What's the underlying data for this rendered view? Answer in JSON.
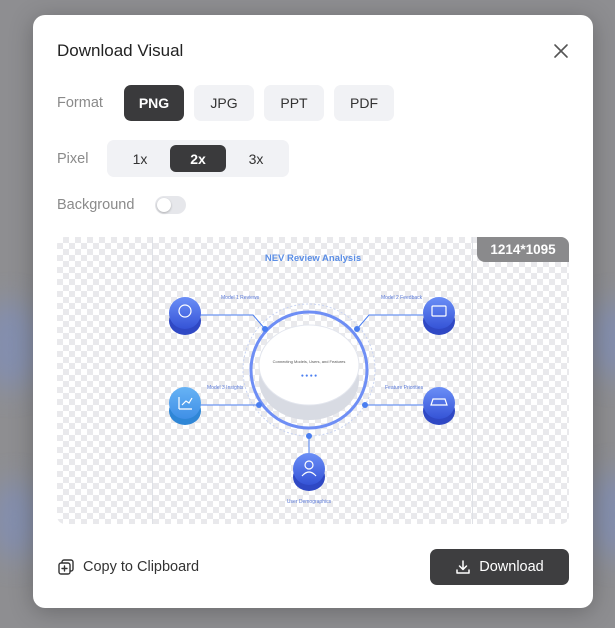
{
  "modal": {
    "title": "Download Visual"
  },
  "format": {
    "label": "Format",
    "options": [
      "PNG",
      "JPG",
      "PPT",
      "PDF"
    ],
    "selected": "PNG"
  },
  "pixel": {
    "label": "Pixel",
    "options": [
      "1x",
      "2x",
      "3x"
    ],
    "selected": "2x"
  },
  "background": {
    "label": "Background",
    "enabled": false
  },
  "preview": {
    "size_badge": "1214*1095",
    "infographic": {
      "title": "NEV Review Analysis",
      "center_text": "Connecting Models, Users, and Features",
      "center_dots": "● ● ● ●",
      "nodes": {
        "model1": "Model 1 Reviews",
        "model2": "Model 2 Feedback",
        "model3": "Model 3 Insights",
        "feature": "Feature Priorities",
        "user": "User Demographics"
      }
    }
  },
  "footer": {
    "copy_label": "Copy to Clipboard",
    "download_label": "Download"
  },
  "colors": {
    "accent_dark": "#3a3a3c",
    "infographic_blue": "#4a7ef0",
    "infographic_title": "#5b8ee6"
  }
}
